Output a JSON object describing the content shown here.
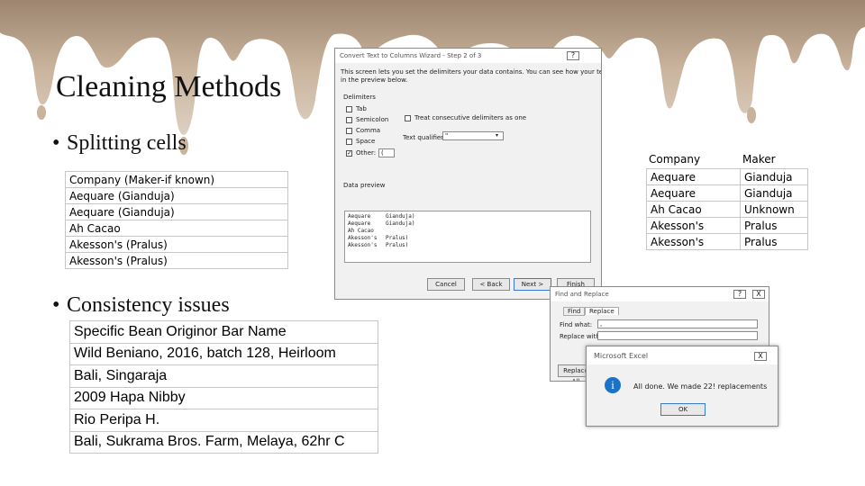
{
  "slide": {
    "title": "Cleaning Methods",
    "bullet1": "Splitting cells",
    "bullet2": "Consistency issues",
    "bullet_char": "•"
  },
  "table_company_maker": {
    "rows": [
      "Company (Maker-if known)",
      "Aequare (Gianduja)",
      "Aequare (Gianduja)",
      "Ah Cacao",
      "Akesson's (Pralus)",
      "Akesson's (Pralus)"
    ]
  },
  "table_split": {
    "header_company": "Company",
    "header_maker": "Maker",
    "rows": [
      [
        "Aequare",
        "Gianduja"
      ],
      [
        "Aequare",
        "Gianduja"
      ],
      [
        "Ah Cacao",
        "Unknown"
      ],
      [
        "Akesson's",
        "Pralus"
      ],
      [
        "Akesson's",
        "Pralus"
      ]
    ]
  },
  "table_origin": {
    "rows": [
      "Specific Bean Originor Bar Name",
      "Wild Beniano, 2016, batch 128, Heirloom",
      "Bali, Singaraja",
      "2009 Hapa Nibby",
      "Rio Peripa H.",
      "Bali, Sukrama Bros. Farm, Melaya, 62hr C"
    ]
  },
  "wizard": {
    "title": "Convert Text to Columns Wizard - Step 2 of 3",
    "close": "?",
    "desc_line1": "This screen lets you set the delimiters your data contains. You can see how your text is affected",
    "desc_line2": "in the preview below.",
    "delimiters_label": "Delimiters",
    "tab": "Tab",
    "semicolon": "Semicolon",
    "comma": "Comma",
    "space": "Space",
    "other": "Other:",
    "other_value": "(",
    "consecutive": "Treat consecutive delimiters as one",
    "qualifier_label": "Text qualifier:",
    "qualifier_value": "\"",
    "preview_label": "Data preview",
    "preview_rows": [
      [
        "Aequare",
        "Gianduja)"
      ],
      [
        "Aequare",
        "Gianduja)"
      ],
      [
        "Ah Cacao",
        ""
      ],
      [
        "Akesson's",
        "Pralus)"
      ],
      [
        "Akesson's",
        "Pralus)"
      ]
    ],
    "cancel": "Cancel",
    "back": "< Back",
    "next": "Next >",
    "finish": "Finish"
  },
  "find_replace": {
    "title": "Find and Replace",
    "close_q": "?",
    "close_x": "X",
    "tab_find": "Find",
    "tab_replace": "Replace",
    "find_label": "Find what:",
    "find_value": ",",
    "replace_label": "Replace with:",
    "replace_value": "",
    "replace_all": "Replace All"
  },
  "excel_msg": {
    "title": "Microsoft Excel",
    "close": "X",
    "message": "All done. We made 22! replacements",
    "ok": "OK",
    "info_glyph": "i"
  },
  "colors": {
    "chocolate_light": "#d8c7b4",
    "chocolate_mid": "#bfa88f",
    "chocolate_dark": "#8f7660",
    "info_blue": "#1a73c9"
  }
}
